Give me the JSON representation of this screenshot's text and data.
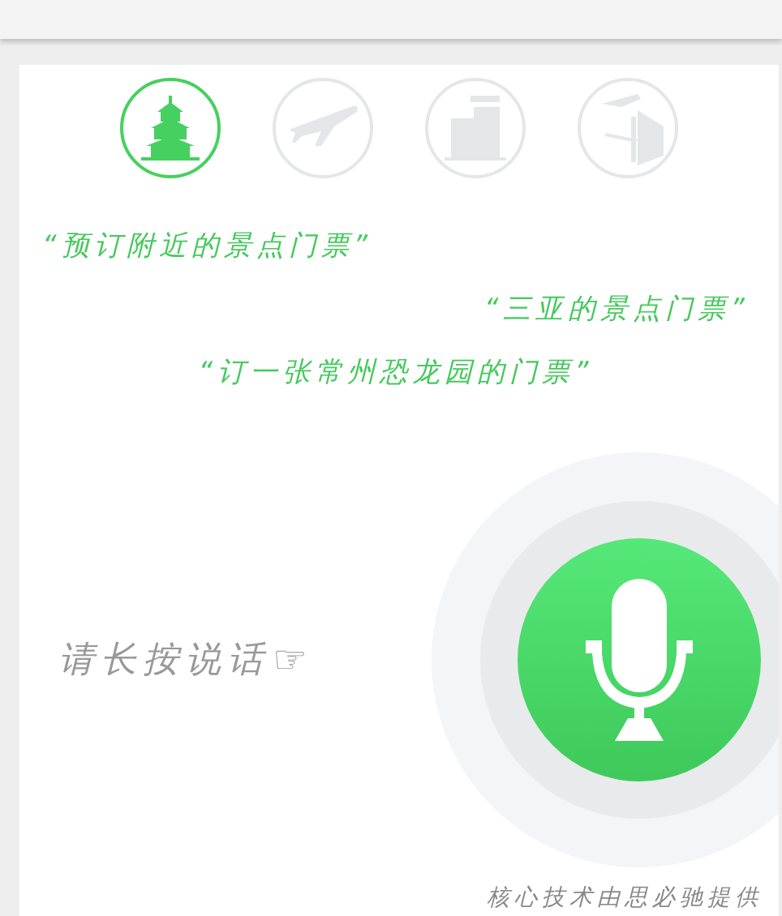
{
  "categories": [
    {
      "kind": "attraction",
      "selected": true
    },
    {
      "kind": "flight",
      "selected": false
    },
    {
      "kind": "hotel",
      "selected": false
    },
    {
      "kind": "transit",
      "selected": false
    }
  ],
  "examples": [
    {
      "text": "“预订附近的景点门票”",
      "kind": "left"
    },
    {
      "text": "“三亚的景点门票”",
      "kind": "right"
    },
    {
      "text": "“订一张常州恐龙园的门票”",
      "kind": "center"
    }
  ],
  "hint": {
    "text": "请长按说话",
    "icon": "☞"
  },
  "credit": "核心技术由思必驰提供"
}
